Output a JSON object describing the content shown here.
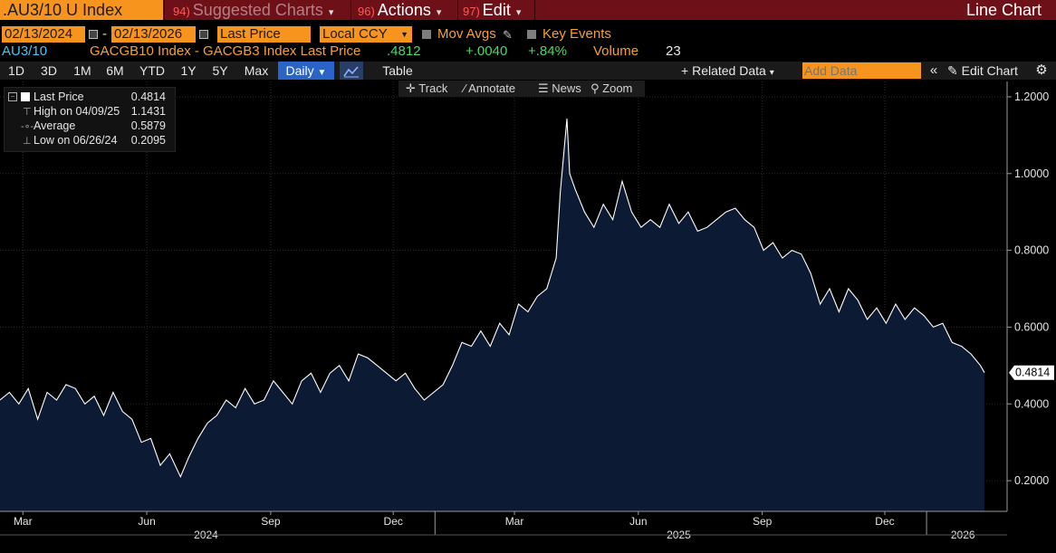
{
  "header": {
    "ticker": ".AU3/10 U Index",
    "menus": [
      {
        "num": "94)",
        "label": "Suggested Charts"
      },
      {
        "num": "96)",
        "label": "Actions"
      },
      {
        "num": "97)",
        "label": "Edit"
      }
    ],
    "view_title": "Line Chart"
  },
  "controls": {
    "start_date": "02/13/2024",
    "date_separator": "-",
    "end_date": "02/13/2026",
    "field": "Last Price",
    "currency": "Local CCY",
    "mov_avgs": "Mov Avgs",
    "key_events": "Key Events"
  },
  "quote": {
    "security": "AU3/10",
    "description": "GACGB10 Index - GACGB3 Index Last Price",
    "last": ".4812",
    "change": "+.0040",
    "pct_change": "+.84%",
    "volume_label": "Volume",
    "volume": "23"
  },
  "ranges": [
    "1D",
    "3D",
    "1M",
    "6M",
    "YTD",
    "1Y",
    "5Y",
    "Max"
  ],
  "frequency": "Daily",
  "table_label": "Table",
  "related_data": "Related Data",
  "add_data_placeholder": "Add Data",
  "edit_chart": "Edit Chart",
  "chart_tools": [
    "Track",
    "Annotate",
    "News",
    "Zoom"
  ],
  "legend": [
    {
      "label": "Last Price",
      "value": "0.4814"
    },
    {
      "label": "High on 04/09/25",
      "value": "1.1431"
    },
    {
      "label": "Average",
      "value": "0.5879"
    },
    {
      "label": "Low on 06/26/24",
      "value": "0.2095"
    }
  ],
  "colors": {
    "area_fill": "#0c1b33",
    "line": "#ffffff",
    "accent": "#f7941d",
    "header_bg": "#6e1018",
    "positive": "#4cd964"
  },
  "chart_data": {
    "type": "area",
    "title": "",
    "xlabel": "",
    "ylabel": "",
    "ylim": [
      0.12,
      1.24
    ],
    "xlim": [
      "2024-02-13",
      "2026-02-13"
    ],
    "y_ticks": [
      "0.2000",
      "0.4000",
      "0.6000",
      "0.8000",
      "1.0000",
      "1.2000"
    ],
    "x_ticks": [
      {
        "label": "Mar",
        "date": "2024-03-01"
      },
      {
        "label": "Jun",
        "date": "2024-06-01"
      },
      {
        "label": "Sep",
        "date": "2024-09-01"
      },
      {
        "label": "Dec",
        "date": "2024-12-01"
      },
      {
        "label": "Mar",
        "date": "2025-03-01"
      },
      {
        "label": "Jun",
        "date": "2025-06-01"
      },
      {
        "label": "Sep",
        "date": "2025-09-01"
      },
      {
        "label": "Dec",
        "date": "2025-12-01"
      }
    ],
    "year_labels": [
      {
        "label": "2024",
        "date": "2024-07-15"
      },
      {
        "label": "2025",
        "date": "2025-07-01"
      },
      {
        "label": "2026",
        "date": "2026-01-28"
      }
    ],
    "year_dividers": [
      "2025-01-01",
      "2026-01-01"
    ],
    "last_label": "0.4814",
    "last_value": 0.4814,
    "grid": true,
    "series": [
      {
        "name": "Last Price",
        "x": [
          "2024-02-13",
          "2024-02-20",
          "2024-02-27",
          "2024-03-05",
          "2024-03-12",
          "2024-03-19",
          "2024-03-26",
          "2024-04-02",
          "2024-04-09",
          "2024-04-16",
          "2024-04-23",
          "2024-04-30",
          "2024-05-07",
          "2024-05-14",
          "2024-05-21",
          "2024-05-28",
          "2024-06-04",
          "2024-06-11",
          "2024-06-18",
          "2024-06-26",
          "2024-07-02",
          "2024-07-09",
          "2024-07-16",
          "2024-07-23",
          "2024-07-30",
          "2024-08-06",
          "2024-08-13",
          "2024-08-20",
          "2024-08-27",
          "2024-09-03",
          "2024-09-10",
          "2024-09-17",
          "2024-09-24",
          "2024-10-01",
          "2024-10-08",
          "2024-10-15",
          "2024-10-22",
          "2024-10-29",
          "2024-11-05",
          "2024-11-12",
          "2024-11-19",
          "2024-11-26",
          "2024-12-03",
          "2024-12-10",
          "2024-12-17",
          "2024-12-24",
          "2025-01-07",
          "2025-01-14",
          "2025-01-21",
          "2025-01-28",
          "2025-02-04",
          "2025-02-11",
          "2025-02-18",
          "2025-02-25",
          "2025-03-04",
          "2025-03-11",
          "2025-03-18",
          "2025-03-25",
          "2025-04-01",
          "2025-04-04",
          "2025-04-09",
          "2025-04-11",
          "2025-04-15",
          "2025-04-22",
          "2025-04-29",
          "2025-05-06",
          "2025-05-13",
          "2025-05-20",
          "2025-05-27",
          "2025-06-03",
          "2025-06-10",
          "2025-06-17",
          "2025-06-24",
          "2025-07-01",
          "2025-07-08",
          "2025-07-15",
          "2025-07-22",
          "2025-07-29",
          "2025-08-05",
          "2025-08-12",
          "2025-08-19",
          "2025-08-26",
          "2025-09-02",
          "2025-09-09",
          "2025-09-16",
          "2025-09-23",
          "2025-09-30",
          "2025-10-07",
          "2025-10-14",
          "2025-10-21",
          "2025-10-28",
          "2025-11-04",
          "2025-11-11",
          "2025-11-18",
          "2025-11-25",
          "2025-12-02",
          "2025-12-09",
          "2025-12-16",
          "2025-12-23",
          "2025-12-30",
          "2026-01-06",
          "2026-01-13",
          "2026-01-20",
          "2026-01-27",
          "2026-02-03",
          "2026-02-10",
          "2026-02-13"
        ],
        "y": [
          0.41,
          0.43,
          0.4,
          0.44,
          0.36,
          0.43,
          0.41,
          0.45,
          0.44,
          0.4,
          0.42,
          0.37,
          0.43,
          0.38,
          0.36,
          0.3,
          0.31,
          0.24,
          0.27,
          0.21,
          0.26,
          0.31,
          0.35,
          0.37,
          0.41,
          0.39,
          0.44,
          0.4,
          0.41,
          0.46,
          0.43,
          0.4,
          0.46,
          0.48,
          0.43,
          0.48,
          0.5,
          0.46,
          0.53,
          0.52,
          0.5,
          0.48,
          0.46,
          0.48,
          0.44,
          0.41,
          0.45,
          0.5,
          0.56,
          0.55,
          0.59,
          0.55,
          0.61,
          0.58,
          0.66,
          0.64,
          0.68,
          0.7,
          0.78,
          0.95,
          1.1431,
          1.0,
          0.96,
          0.9,
          0.86,
          0.92,
          0.88,
          0.98,
          0.9,
          0.86,
          0.88,
          0.86,
          0.92,
          0.87,
          0.9,
          0.85,
          0.86,
          0.88,
          0.9,
          0.91,
          0.88,
          0.86,
          0.8,
          0.82,
          0.78,
          0.8,
          0.79,
          0.74,
          0.66,
          0.7,
          0.64,
          0.7,
          0.67,
          0.62,
          0.65,
          0.61,
          0.66,
          0.62,
          0.65,
          0.63,
          0.6,
          0.61,
          0.56,
          0.55,
          0.53,
          0.5,
          0.4814
        ]
      }
    ]
  }
}
